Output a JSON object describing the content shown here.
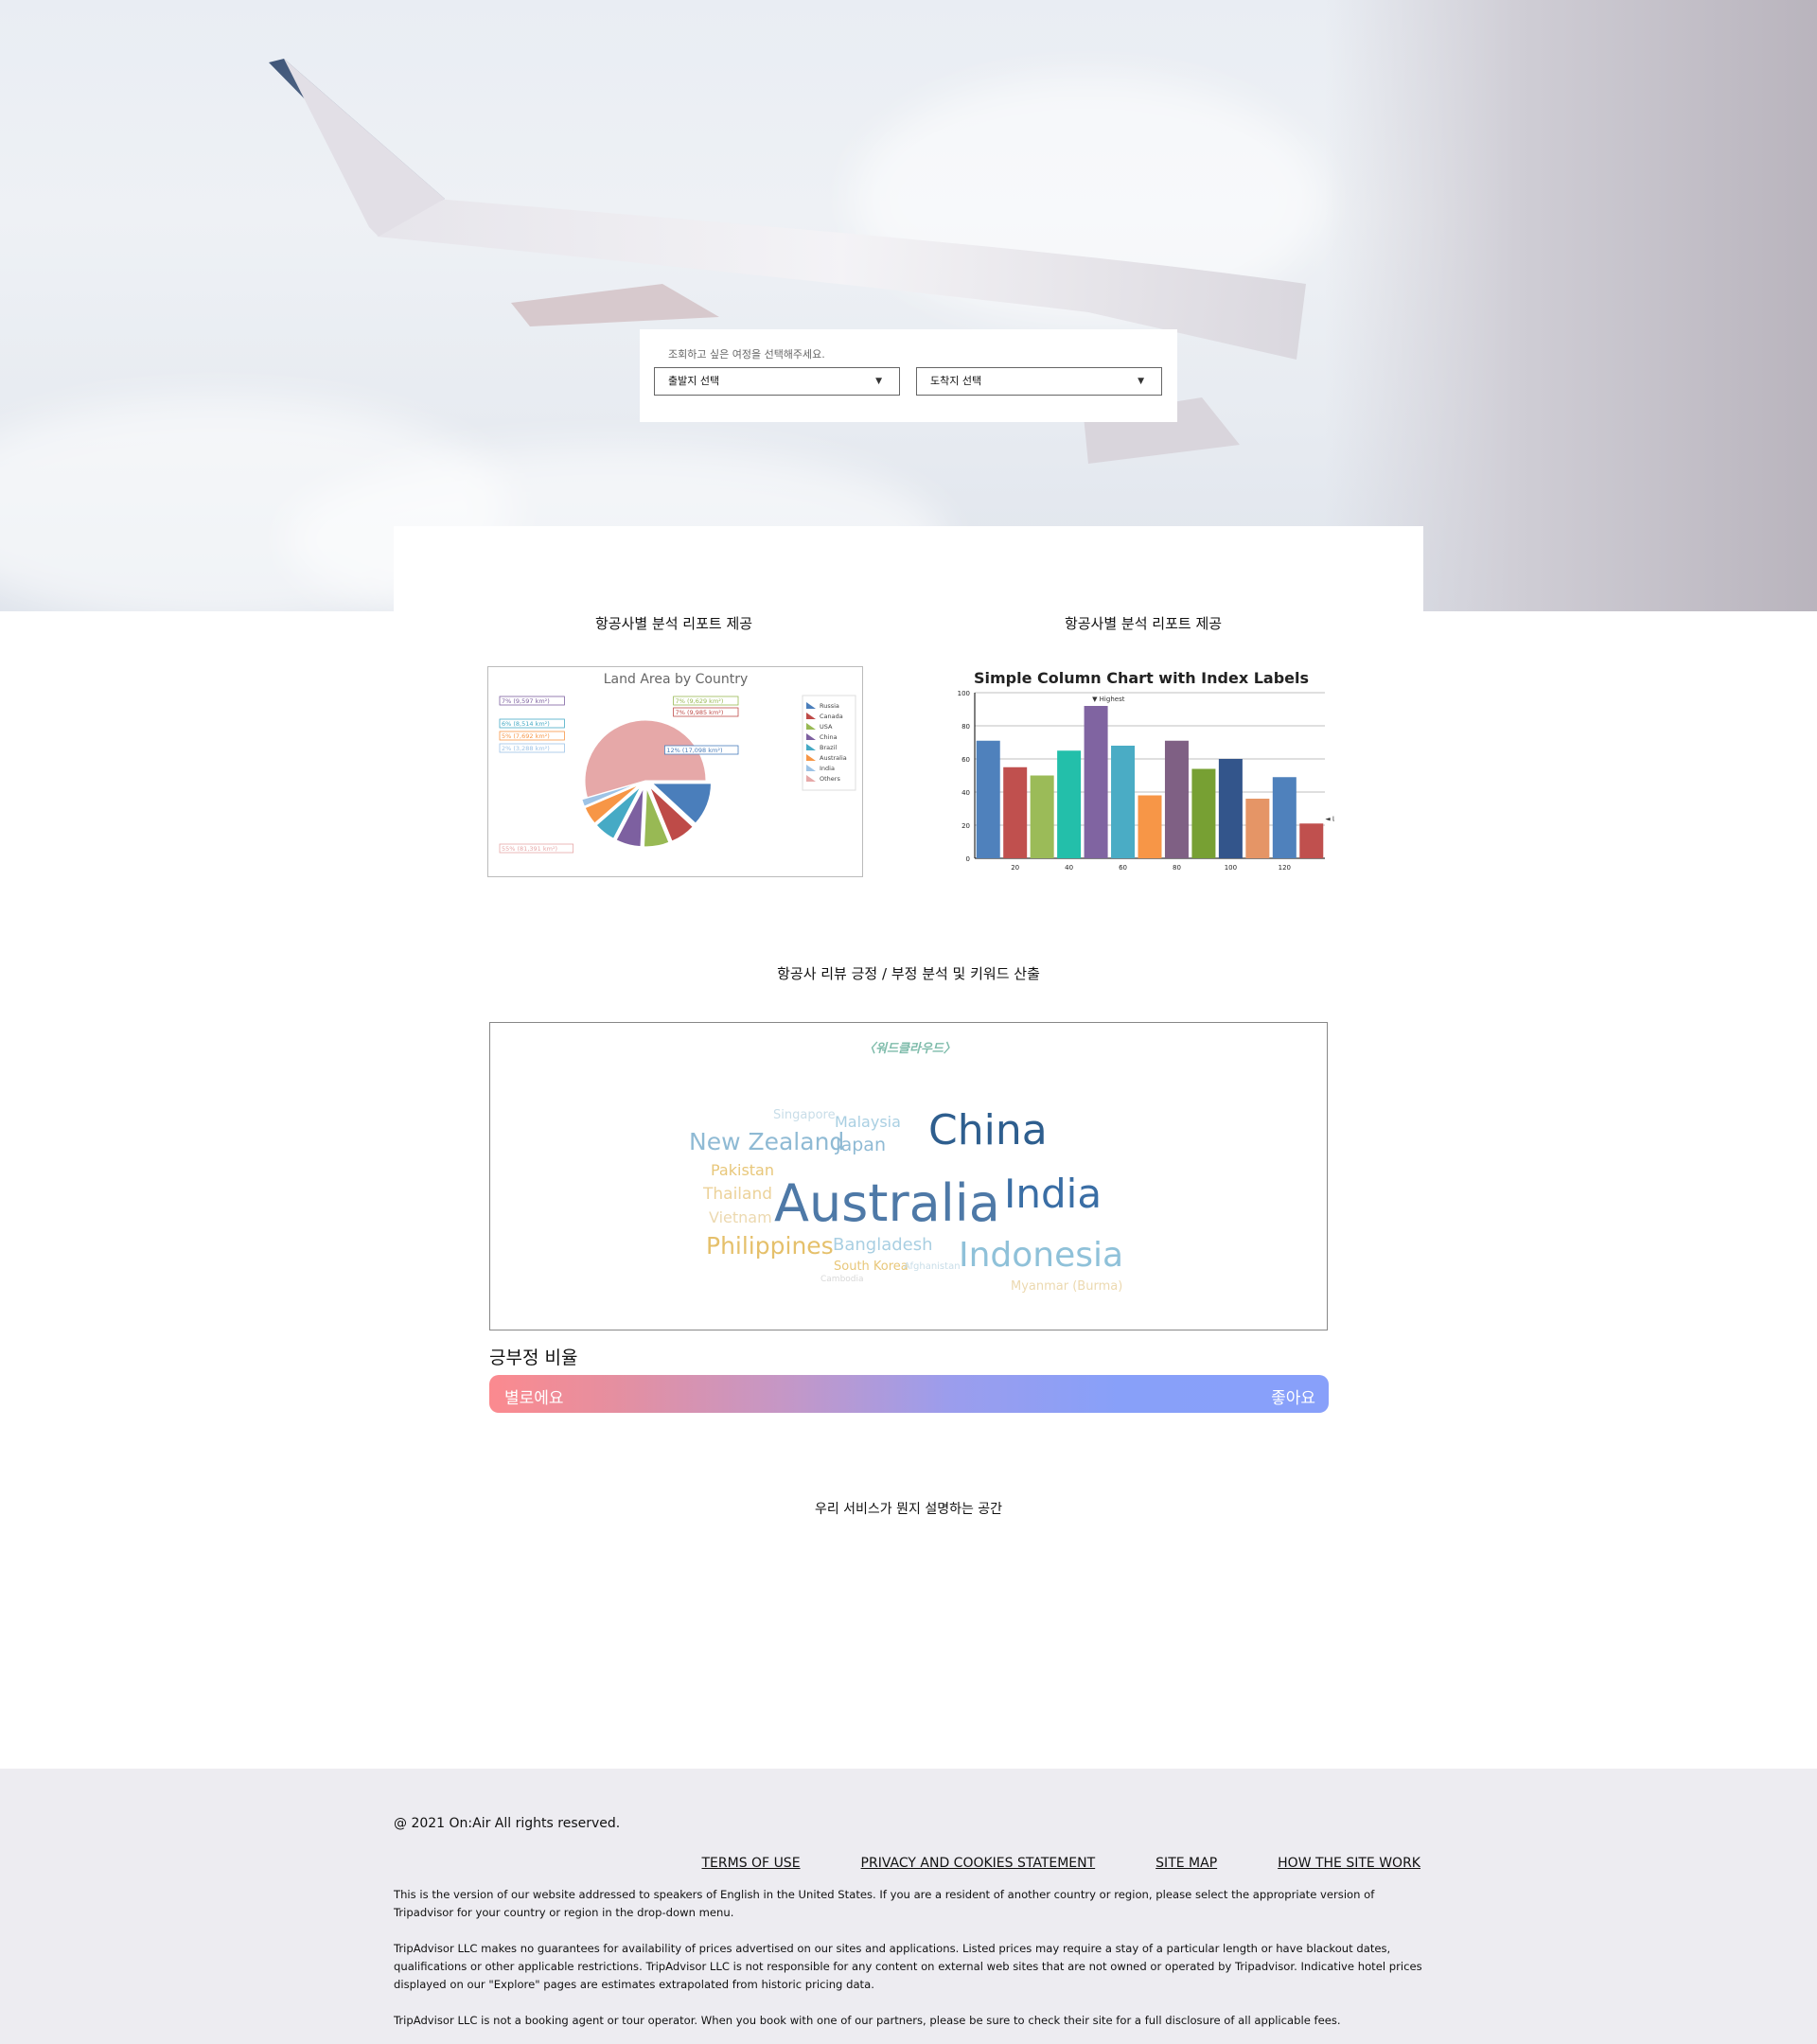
{
  "search": {
    "hint": "조회하고 싶은 여정을 선택해주세요.",
    "departure": "출발지 선택",
    "arrival": "도착지 선택"
  },
  "sections": {
    "report_left": "항공사별 분석 리포트 제공",
    "report_right": "항공사별 분석 리포트 제공",
    "review": "항공사 리뷰 긍정 / 부정 분석 및 키워드 산출",
    "service": "우리 서비스가 뭔지 설명하는 공간"
  },
  "chart_data": [
    {
      "type": "pie",
      "title": "Land Area by Country",
      "categories": [
        "Russia",
        "Canada",
        "USA",
        "China",
        "Brazil",
        "Australia",
        "India",
        "Others"
      ],
      "values": [
        12,
        7,
        7,
        7,
        6,
        5,
        2,
        55
      ],
      "labels": [
        "12% (17,098 km²)",
        "7% (9,985 km²)",
        "7% (9,629 km²)",
        "7% (9,597 km²)",
        "6% (8,514 km²)",
        "5% (7,692 km²)",
        "2% (3,288 km²)",
        "55% (81,391 km²)"
      ],
      "colors": [
        "#4a7ebb",
        "#be4b48",
        "#98b954",
        "#7d60a0",
        "#46aac5",
        "#f79646",
        "#9dc3e6",
        "#e6a8a8"
      ],
      "legend": "right"
    },
    {
      "type": "bar",
      "title": "Simple Column Chart with Index Labels",
      "x": [
        10,
        20,
        30,
        40,
        50,
        60,
        70,
        80,
        90,
        100,
        110,
        120,
        130
      ],
      "values": [
        71,
        55,
        50,
        65,
        92,
        68,
        38,
        71,
        54,
        60,
        36,
        49,
        21
      ],
      "colors": [
        "#4f81bc",
        "#c0504e",
        "#9bbb58",
        "#23bfaa",
        "#8064a1",
        "#4aacc5",
        "#f79647",
        "#7f6084",
        "#77a033",
        "#33558b",
        "#e59566",
        "#4f81bc",
        "#c0504e"
      ],
      "index_labels": {
        "4": "Highest",
        "12": "Lowest"
      },
      "ylim": [
        0,
        100
      ],
      "yticks": [
        0,
        20,
        40,
        60,
        80,
        100
      ],
      "xticks": [
        20,
        40,
        60,
        80,
        100,
        120
      ]
    }
  ],
  "wordcloud": {
    "title": "〈워드클라우드〉",
    "words": [
      {
        "text": "Australia",
        "size": 54,
        "color": "#4e79a7"
      },
      {
        "text": "China",
        "size": 44,
        "color": "#2e5e8e"
      },
      {
        "text": "India",
        "size": 42,
        "color": "#3a6ea5"
      },
      {
        "text": "Indonesia",
        "size": 36,
        "color": "#8fc1d9"
      },
      {
        "text": "New Zealand",
        "size": 25,
        "color": "#8fbad4"
      },
      {
        "text": "Philippines",
        "size": 25,
        "color": "#e5c06b"
      },
      {
        "text": "Japan",
        "size": 19,
        "color": "#8fbad4"
      },
      {
        "text": "Bangladesh",
        "size": 18,
        "color": "#a9cfe2"
      },
      {
        "text": "Malaysia",
        "size": 16,
        "color": "#a9cfe2"
      },
      {
        "text": "Pakistan",
        "size": 16,
        "color": "#e8c77a"
      },
      {
        "text": "Thailand",
        "size": 17,
        "color": "#ecd29a"
      },
      {
        "text": "Vietnam",
        "size": 16,
        "color": "#ecd9b0"
      },
      {
        "text": "Singapore",
        "size": 13,
        "color": "#c8dde8"
      },
      {
        "text": "South Korea",
        "size": 13,
        "color": "#e8c77a"
      },
      {
        "text": "Myanmar (Burma)",
        "size": 13,
        "color": "#ecd9b0"
      },
      {
        "text": "Afghanistan",
        "size": 10,
        "color": "#c8dde8"
      },
      {
        "text": "Cambodia",
        "size": 9,
        "color": "#d8d8d8"
      }
    ]
  },
  "sentiment": {
    "title": "긍부정 비율",
    "negative": "별로에요",
    "positive": "좋아요"
  },
  "footer": {
    "copyright": "@ 2021 On:Air All rights reserved.",
    "links": [
      "TERMS OF USE",
      "PRIVACY AND COOKIES STATEMENT",
      "SITE MAP",
      "HOW THE SITE WORK"
    ],
    "para1": "This is the version of our website addressed to speakers of English in the United States. If you are a resident of another country or region, please select the appropriate version of Tripadvisor for your country or region in the drop-down menu.",
    "para2": "TripAdvisor LLC makes no guarantees for availability of prices advertised on our sites and applications. Listed prices may require a stay of a particular length or have blackout dates, qualifications or other applicable restrictions. TripAdvisor LLC is not responsible for any content on external web sites that are not owned or operated by Tripadvisor. Indicative hotel prices displayed on our \"Explore\" pages are estimates extrapolated from historic pricing data.",
    "para3": "TripAdvisor LLC is not a booking agent or tour operator. When you book with one of our partners, please be sure to check their site for a full disclosure of all applicable fees."
  }
}
